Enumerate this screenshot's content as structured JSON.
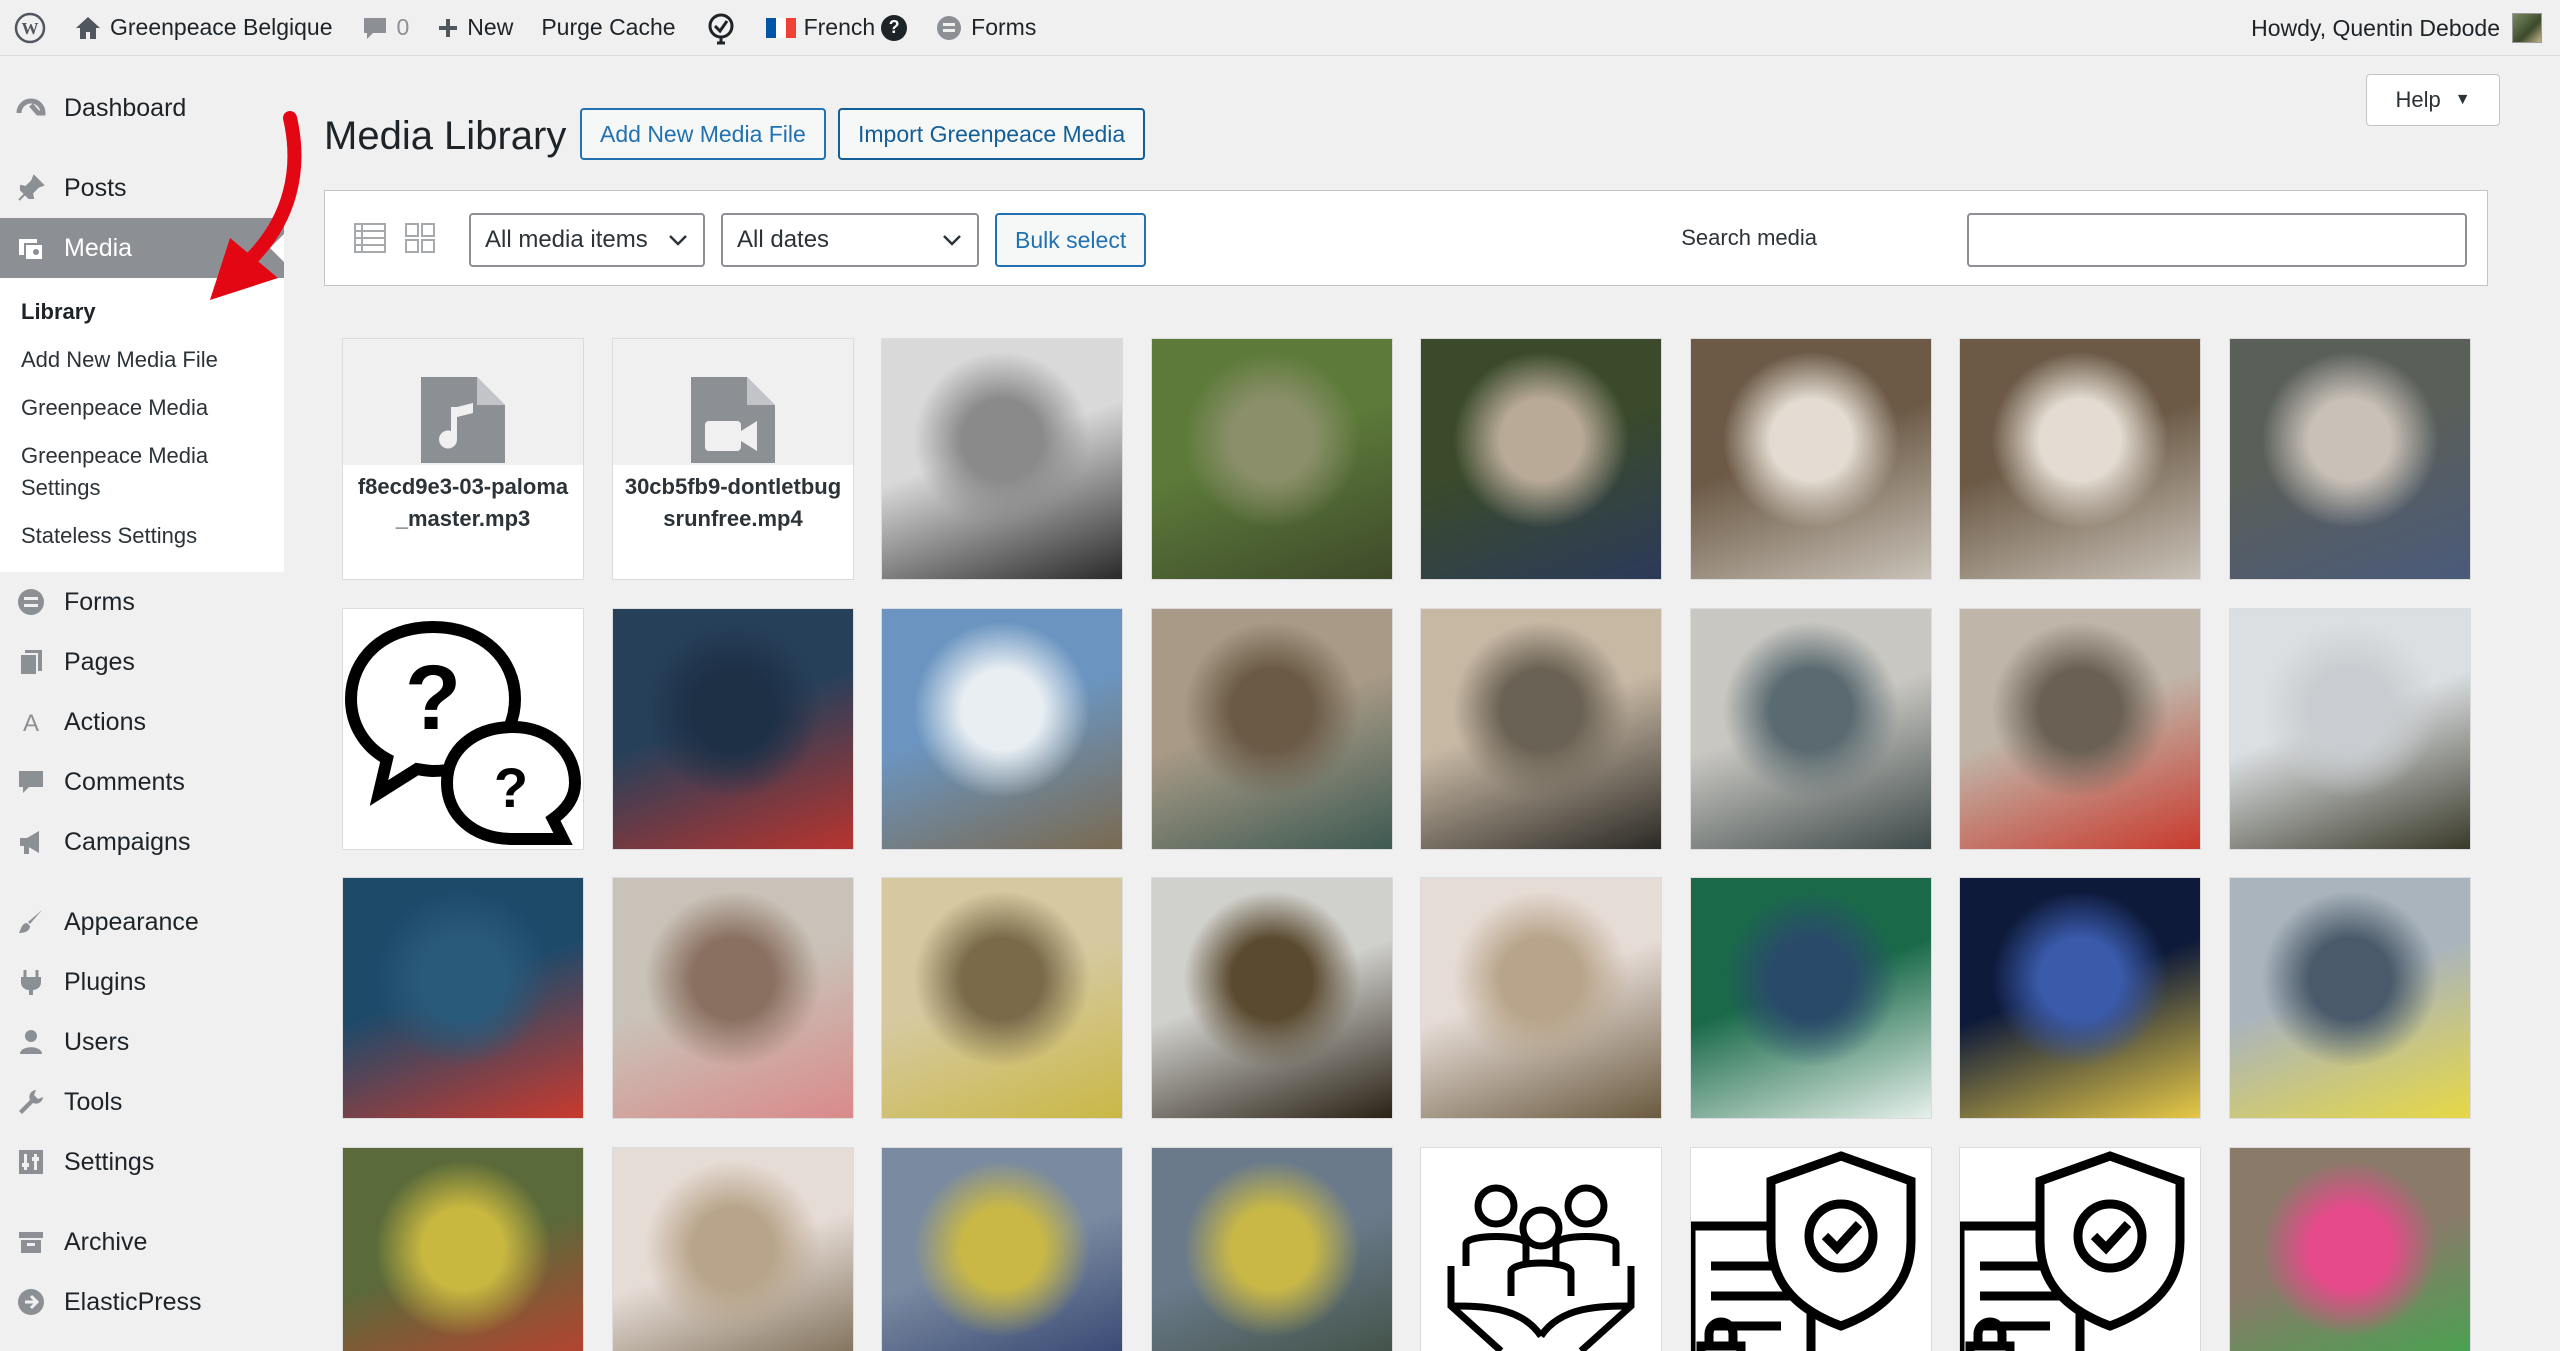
{
  "adminbar": {
    "site_name": "Greenpeace Belgique",
    "comments_count": "0",
    "new_label": "New",
    "purge_cache_label": "Purge Cache",
    "language_label": "French",
    "forms_label": "Forms",
    "howdy": "Howdy, Quentin Debode"
  },
  "sidebar": {
    "items_top": [
      {
        "label": "Dashboard",
        "icon": "dashboard-icon"
      },
      {
        "label": "Posts",
        "icon": "pin-icon"
      },
      {
        "label": "Media",
        "icon": "media-icon"
      }
    ],
    "submenu": [
      "Library",
      "Add New Media File",
      "Greenpeace Media",
      "Greenpeace Media Settings",
      "Stateless Settings"
    ],
    "items_group1": [
      {
        "label": "Forms",
        "icon": "forms-icon"
      },
      {
        "label": "Pages",
        "icon": "pages-icon"
      },
      {
        "label": "Actions",
        "icon": "actions-icon"
      },
      {
        "label": "Comments",
        "icon": "comments-icon"
      },
      {
        "label": "Campaigns",
        "icon": "campaigns-icon"
      }
    ],
    "items_group2": [
      {
        "label": "Appearance",
        "icon": "brush-icon"
      },
      {
        "label": "Plugins",
        "icon": "plug-icon"
      },
      {
        "label": "Users",
        "icon": "users-icon"
      },
      {
        "label": "Tools",
        "icon": "wrench-icon"
      },
      {
        "label": "Settings",
        "icon": "settings-icon"
      }
    ],
    "items_group3": [
      {
        "label": "Archive",
        "icon": "archive-icon"
      },
      {
        "label": "ElasticPress",
        "icon": "elasticpress-icon"
      }
    ]
  },
  "main": {
    "help_label": "Help",
    "title": "Media Library",
    "add_new_label": "Add New Media File",
    "import_label": "Import Greenpeace Media",
    "filter_type": "All media items",
    "filter_date": "All dates",
    "bulk_select_label": "Bulk select",
    "search_label": "Search media",
    "search_value": ""
  },
  "media": [
    {
      "kind": "file",
      "icon": "audio-file-icon",
      "filename": "f8ecd9e3-03-paloma_master.mp3"
    },
    {
      "kind": "file",
      "icon": "video-file-icon",
      "filename": "30cb5fb9-dontletbugsrunfree.mp4"
    },
    {
      "kind": "photo",
      "colors": [
        "#d9d9d9",
        "#8a8a8a",
        "#2a2a2a"
      ]
    },
    {
      "kind": "photo",
      "colors": [
        "#5d7a3a",
        "#8b8f6a",
        "#3e4a2a"
      ]
    },
    {
      "kind": "photo",
      "colors": [
        "#3a4a2a",
        "#b9aa98",
        "#2c3a5a"
      ]
    },
    {
      "kind": "photo",
      "colors": [
        "#6c5a46",
        "#e3dcd2",
        "#c9c2b8"
      ]
    },
    {
      "kind": "photo",
      "colors": [
        "#6c5a46",
        "#e3dcd2",
        "#c9c2b8"
      ]
    },
    {
      "kind": "photo",
      "colors": [
        "#5a5f5a",
        "#c9c1b8",
        "#4a5a7a"
      ]
    },
    {
      "kind": "icon",
      "icon": "question-bubbles-icon"
    },
    {
      "kind": "photo",
      "colors": [
        "#27405a",
        "#1d3046",
        "#b8342e"
      ]
    },
    {
      "kind": "photo",
      "colors": [
        "#6b95c0",
        "#e8eef2",
        "#7a6a50"
      ]
    },
    {
      "kind": "photo",
      "colors": [
        "#a89a86",
        "#6a5a46",
        "#3e5a52"
      ]
    },
    {
      "kind": "photo",
      "colors": [
        "#c7b8a4",
        "#6a6254",
        "#2c2a26"
      ]
    },
    {
      "kind": "photo",
      "colors": [
        "#c9c7c2",
        "#5a6a70",
        "#3e4a4a"
      ]
    },
    {
      "kind": "photo",
      "colors": [
        "#bfb5a8",
        "#6a6054",
        "#c93a2e"
      ]
    },
    {
      "kind": "photo",
      "colors": [
        "#dcdfe2",
        "#c9ccd0",
        "#3a3a2a"
      ]
    },
    {
      "kind": "photo",
      "colors": [
        "#1e4a6a",
        "#2a5a7a",
        "#c93a2e"
      ]
    },
    {
      "kind": "photo",
      "colors": [
        "#c9c2b8",
        "#8a7060",
        "#d98a8a"
      ]
    },
    {
      "kind": "photo",
      "colors": [
        "#d6c9a0",
        "#7a6a4a",
        "#c9b846"
      ]
    },
    {
      "kind": "photo",
      "colors": [
        "#d0d0cc",
        "#5a4a30",
        "#2a2216"
      ]
    },
    {
      "kind": "photo",
      "colors": [
        "#e6dcd6",
        "#b8a48a",
        "#6a5a40"
      ]
    },
    {
      "kind": "photo",
      "colors": [
        "#1a6a4a",
        "#2a4a6a",
        "#e6f0ea"
      ]
    },
    {
      "kind": "photo",
      "colors": [
        "#0e1a3a",
        "#3a5aaa",
        "#e6c846"
      ]
    },
    {
      "kind": "photo",
      "colors": [
        "#aab4bc",
        "#4a5a6a",
        "#e6d846"
      ]
    },
    {
      "kind": "photo",
      "colors": [
        "#5a6a3a",
        "#c9b840",
        "#c93a2e"
      ]
    },
    {
      "kind": "photo",
      "colors": [
        "#e6dcd6",
        "#b8a48a",
        "#6a5a40"
      ]
    },
    {
      "kind": "photo",
      "colors": [
        "#7a8aa0",
        "#c9b846",
        "#2a3a6a"
      ]
    },
    {
      "kind": "photo",
      "colors": [
        "#6a7a8a",
        "#c9b846",
        "#3a4a3a"
      ]
    },
    {
      "kind": "icon",
      "icon": "hands-people-icon"
    },
    {
      "kind": "icon",
      "icon": "document-shield-icon"
    },
    {
      "kind": "icon",
      "icon": "document-shield-icon"
    },
    {
      "kind": "photo",
      "colors": [
        "#8a7a6a",
        "#e64a8a",
        "#3aaa4a"
      ]
    }
  ],
  "colors": {
    "accent": "#2271b1",
    "active_menu": "#8c8f94",
    "arrow": "#e30613"
  }
}
